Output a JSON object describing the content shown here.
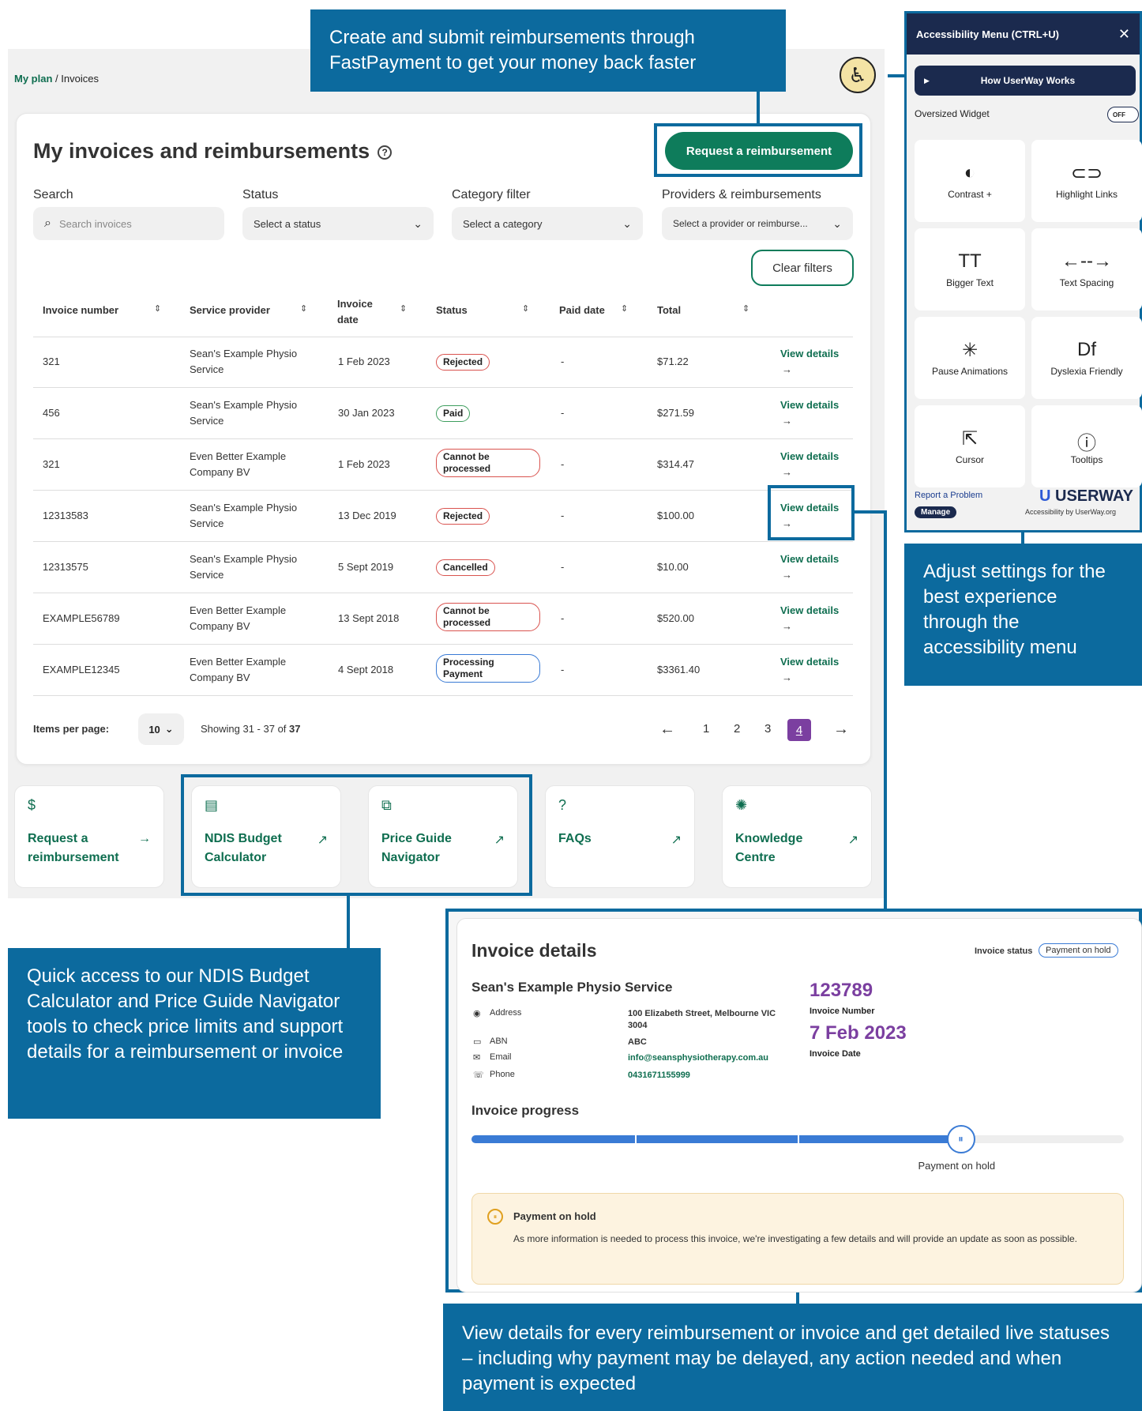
{
  "callouts": {
    "fastpayment": "Create and submit reimbursements through FastPayment to get your money back faster",
    "accessibility": "Adjust settings for the best experience through the accessibility menu",
    "tools": "Quick access to our NDIS Budget Calculator and Price Guide Navigator tools to check price limits and support details for a reimbursement or invoice",
    "details": "View details for every reimbursement or invoice and get detailed live statuses – including why payment may be delayed, any action needed and when payment is expected"
  },
  "breadcrumb": {
    "link": "My plan",
    "sep": " / ",
    "current": "Invoices"
  },
  "page": {
    "title": "My invoices and reimbursements",
    "help_icon": "?",
    "request_btn": "Request a reimbursement",
    "clear_btn": "Clear filters"
  },
  "filters": {
    "search_label": "Search",
    "search_placeholder": "Search invoices",
    "status_label": "Status",
    "status_value": "Select a status",
    "category_label": "Category filter",
    "category_value": "Select a category",
    "provider_label": "Providers & reimbursements",
    "provider_value": "Select a provider or reimburse..."
  },
  "table": {
    "headers": [
      "Invoice number",
      "Service provider",
      "Invoice date",
      "Status",
      "Paid date",
      "Total"
    ],
    "view_label": "View details",
    "rows": [
      {
        "num": "321",
        "provider": "Sean's Example Physio Service",
        "date": "1 Feb 2023",
        "status": "Rejected",
        "paid": "-",
        "total": "$71.22"
      },
      {
        "num": "456",
        "provider": "Sean's Example Physio Service",
        "date": "30 Jan 2023",
        "status": "Paid",
        "paid": "-",
        "total": "$271.59"
      },
      {
        "num": "321",
        "provider": "Even Better Example Company BV",
        "date": "1 Feb 2023",
        "status": "Cannot be processed",
        "paid": "-",
        "total": "$314.47"
      },
      {
        "num": "12313583",
        "provider": "Sean's Example Physio Service",
        "date": "13 Dec 2019",
        "status": "Rejected",
        "paid": "-",
        "total": "$100.00"
      },
      {
        "num": "12313575",
        "provider": "Sean's Example Physio Service",
        "date": "5 Sept 2019",
        "status": "Cancelled",
        "paid": "-",
        "total": "$10.00"
      },
      {
        "num": "EXAMPLE56789",
        "provider": "Even Better Example Company BV",
        "date": "13 Sept 2018",
        "status": "Cannot be processed",
        "paid": "-",
        "total": "$520.00"
      },
      {
        "num": "EXAMPLE12345",
        "provider": "Even Better Example Company BV",
        "date": "4 Sept 2018",
        "status": "Processing Payment",
        "paid": "-",
        "total": "$3361.40"
      }
    ]
  },
  "pagination": {
    "items_label": "Items per page:",
    "items_value": "10",
    "showing_prefix": "Showing 31 - 37 of ",
    "showing_total": "37",
    "pages": [
      "1",
      "2",
      "3",
      "4"
    ],
    "current": "4"
  },
  "tiles": [
    {
      "icon": "$",
      "label": "Request a reimbursement",
      "ext": "→"
    },
    {
      "icon": "▤",
      "label": "NDIS Budget Calculator",
      "ext": "↗"
    },
    {
      "icon": "⧉",
      "label": "Price Guide Navigator",
      "ext": "↗"
    },
    {
      "icon": "?",
      "label": "FAQs",
      "ext": "↗"
    },
    {
      "icon": "✺",
      "label": "Knowledge Centre",
      "ext": "↗"
    }
  ],
  "access_menu": {
    "title": "Accessibility Menu (CTRL+U)",
    "close": "✕",
    "how": "How UserWay Works",
    "oversized": "Oversized Widget",
    "toggle": "OFF",
    "items": [
      {
        "icon": "◐",
        "label": "Contrast +"
      },
      {
        "icon": "⊂⊃",
        "label": "Highlight Links"
      },
      {
        "icon": "TT",
        "label": "Bigger Text"
      },
      {
        "icon": "←--→",
        "label": "Text Spacing"
      },
      {
        "icon": "✳",
        "label": "Pause Animations"
      },
      {
        "icon": "Df",
        "label": "Dyslexia Friendly"
      },
      {
        "icon": "⇱",
        "label": "Cursor"
      },
      {
        "icon": "ⓘ",
        "label": "Tooltips"
      }
    ],
    "report": "Report a Problem",
    "manage": "Manage",
    "brand": "USERWAY",
    "brand_sub": "Accessibility by UserWay.org"
  },
  "details": {
    "title": "Invoice details",
    "status_label": "Invoice status",
    "status_value": "Payment on hold",
    "provider": "Sean's Example Physio Service",
    "fields": [
      {
        "icon": "◉",
        "label": "Address",
        "value": "100 Elizabeth Street, Melbourne VIC 3004"
      },
      {
        "icon": "▭",
        "label": "ABN",
        "value": "ABC"
      },
      {
        "icon": "✉",
        "label": "Email",
        "value": "info@seansphysiotherapy.com.au"
      },
      {
        "icon": "☏",
        "label": "Phone",
        "value": "0431671155999"
      }
    ],
    "invoice_number": "123789",
    "invoice_number_label": "Invoice Number",
    "invoice_date": "7 Feb 2023",
    "invoice_date_label": "Invoice Date",
    "progress_label": "Invoice progress",
    "progress_fraction": 0.75,
    "progress_state": "Payment on hold",
    "notice_title": "Payment on hold",
    "notice_text": "As more information is needed to process this invoice, we're investigating a few details and will provide an update as soon as possible."
  }
}
